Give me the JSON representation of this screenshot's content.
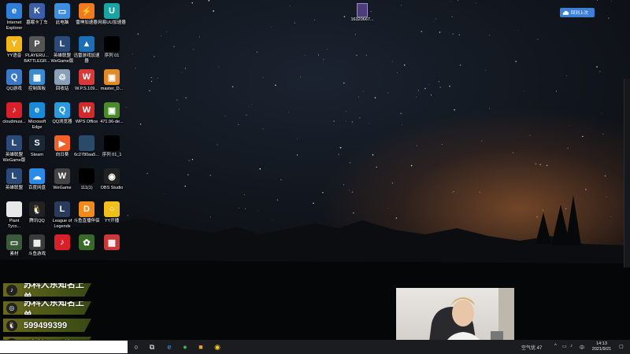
{
  "desktop": {
    "icons": [
      {
        "label": "Internet\nExplorer",
        "icon": "internet-explorer-icon",
        "color": "#2f7fd8",
        "glyph": "e"
      },
      {
        "label": "墓眠卡丁车",
        "icon": "kart-game-icon",
        "color": "#3a5ea8",
        "glyph": "K"
      },
      {
        "label": "此电脑",
        "icon": "this-pc-icon",
        "color": "#3c8ee0",
        "glyph": "▭"
      },
      {
        "label": "雷神加速器",
        "icon": "leishen-accelerator-icon",
        "color": "#f07a20",
        "glyph": "⚡"
      },
      {
        "label": "网易UU加速器",
        "icon": "uu-accelerator-icon",
        "color": "#1aa3a3",
        "glyph": "U"
      },
      {
        "label": "YY语音",
        "icon": "yy-voice-icon",
        "color": "#f2b51a",
        "glyph": "Y"
      },
      {
        "label": "PLAYERU...\nBATTLEGR...",
        "icon": "pubg-icon",
        "color": "#555",
        "glyph": "P"
      },
      {
        "label": "英雄联盟\nWeGame版",
        "icon": "lol-wegame-icon",
        "color": "#2b4a7a",
        "glyph": "L"
      },
      {
        "label": "迅雷游戏加速器",
        "icon": "xunlei-accelerator-icon",
        "color": "#1a6fb8",
        "glyph": "▲"
      },
      {
        "label": "序列 01",
        "icon": "sequence-file-icon",
        "color": "#000",
        "glyph": ""
      },
      {
        "label": "QQ游戏",
        "icon": "qq-game-icon",
        "color": "#3a78c8",
        "glyph": "Q"
      },
      {
        "label": "控制面板",
        "icon": "control-panel-icon",
        "color": "#3a8ad0",
        "glyph": "▦"
      },
      {
        "label": "回收站",
        "icon": "recycle-bin-icon",
        "color": "#8aa0b8",
        "glyph": "♲"
      },
      {
        "label": "W.P.S.109...",
        "icon": "wps-installer-icon",
        "color": "#d83a3a",
        "glyph": "W"
      },
      {
        "label": "master_D...",
        "icon": "master-file-icon",
        "color": "#e08a2a",
        "glyph": "▣"
      },
      {
        "label": "cloudmusi...",
        "icon": "cloudmusic-icon",
        "color": "#d8202a",
        "glyph": "♪"
      },
      {
        "label": "Microsoft\nEdge",
        "icon": "edge-icon",
        "color": "#1a8ad8",
        "glyph": "e"
      },
      {
        "label": "QQ浏览器",
        "icon": "qq-browser-icon",
        "color": "#2a9ae0",
        "glyph": "Q"
      },
      {
        "label": "WPS Office",
        "icon": "wps-office-icon",
        "color": "#d02a2a",
        "glyph": "W"
      },
      {
        "label": "471.96-de...",
        "icon": "nvidia-driver-icon",
        "color": "#4a8a2a",
        "glyph": "▣"
      },
      {
        "label": "英雄联盟\nWeGame版",
        "icon": "lol-wegame-icon",
        "color": "#2b4a7a",
        "glyph": "L"
      },
      {
        "label": "Steam",
        "icon": "steam-icon",
        "color": "#1b2838",
        "glyph": "S"
      },
      {
        "label": "向日葵",
        "icon": "sunflower-icon",
        "color": "#f0602a",
        "glyph": "▶"
      },
      {
        "label": "6c2780aa5...",
        "icon": "image-file-icon",
        "color": "#2a4a6a",
        "glyph": ""
      },
      {
        "label": "序列 01_1",
        "icon": "sequence-file-icon",
        "color": "#000",
        "glyph": ""
      },
      {
        "label": "英雄联盟",
        "icon": "lol-icon",
        "color": "#2b4a7a",
        "glyph": "L"
      },
      {
        "label": "百度网盘",
        "icon": "baidu-netdisk-icon",
        "color": "#2a8ae8",
        "glyph": "☁"
      },
      {
        "label": "WeGame",
        "icon": "wegame-icon",
        "color": "#444",
        "glyph": "W"
      },
      {
        "label": "111(1)",
        "icon": "file-icon",
        "color": "#000",
        "glyph": ""
      },
      {
        "label": "OBS Studio",
        "icon": "obs-icon",
        "color": "#222",
        "glyph": "◉"
      },
      {
        "label": "Plant\nTyco...",
        "icon": "document-icon",
        "color": "#e8e8e8",
        "glyph": ""
      },
      {
        "label": "腾讯QQ",
        "icon": "qq-icon",
        "color": "#222",
        "glyph": "🐧"
      },
      {
        "label": "League of\nLegends",
        "icon": "league-icon",
        "color": "#2a3a5a",
        "glyph": "L"
      },
      {
        "label": "斗鱼直播伴侣",
        "icon": "douyu-icon",
        "color": "#f08a1a",
        "glyph": "D"
      },
      {
        "label": "YY开播",
        "icon": "yy-live-icon",
        "color": "#f2c01a",
        "glyph": "○"
      },
      {
        "label": "素材",
        "icon": "folder-icon",
        "color": "#3a5a3a",
        "glyph": "▭"
      },
      {
        "label": "斗鱼游戏",
        "icon": "douyu-game-icon",
        "color": "#3a3a3a",
        "glyph": "▦"
      },
      {
        "label": "",
        "icon": "netease-music-icon",
        "color": "#d8202a",
        "glyph": "♪"
      },
      {
        "label": "",
        "icon": "plant-icon",
        "color": "#3a6a2a",
        "glyph": "✿"
      },
      {
        "label": "",
        "icon": "app-grid-icon",
        "color": "#c83a3a",
        "glyph": "▦"
      }
    ],
    "top_file_label": "16320667...",
    "top_right_button": "回到上次"
  },
  "overlay": {
    "banners": [
      {
        "icon": "douyin-icon",
        "glyph": "♪",
        "text": "苏科大东知名上单"
      },
      {
        "icon": "weibo-icon",
        "glyph": "◎",
        "text": "苏科大东知名上单"
      },
      {
        "icon": "qq-icon",
        "glyph": "🐧",
        "text": "599499399"
      },
      {
        "icon": "wechat-icon",
        "glyph": "✉",
        "text": "=房管+vx群"
      }
    ]
  },
  "taskbar": {
    "tray_text": "空气优 47",
    "time": "14:13",
    "date": "2021/9/21"
  }
}
